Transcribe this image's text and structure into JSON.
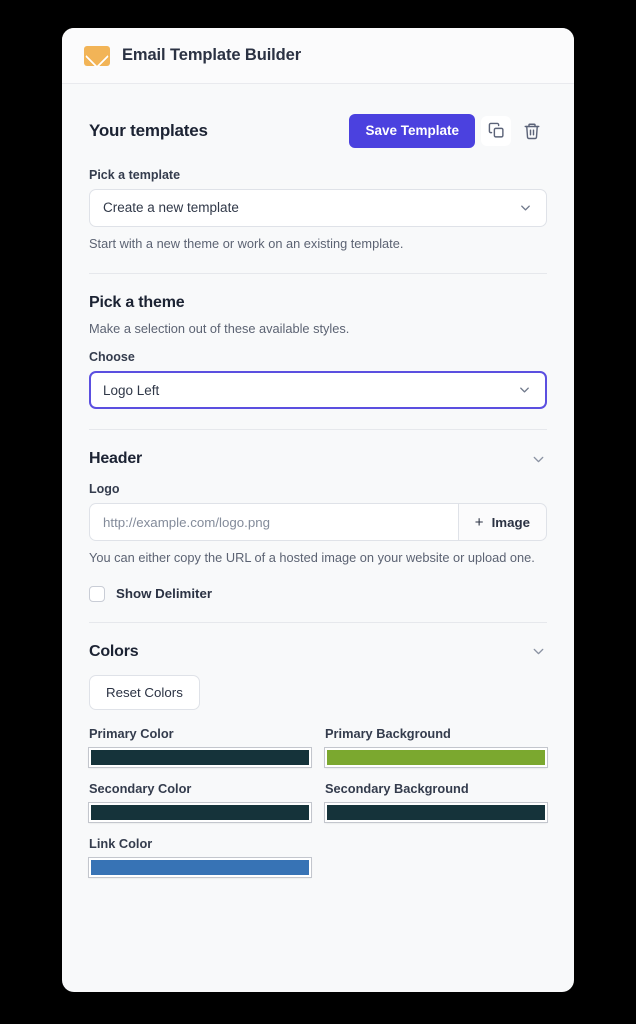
{
  "app": {
    "title": "Email Template Builder",
    "logo_icon": "envelope-icon"
  },
  "templates_section": {
    "heading": "Your templates",
    "save_button": "Save Template",
    "duplicate_icon": "copy-icon",
    "delete_icon": "trash-icon",
    "picker_label": "Pick a template",
    "picker_value": "Create a new template",
    "picker_chevron_icon": "chevron-down-icon",
    "helper_text": "Start with a new theme or work on an existing template."
  },
  "theme_section": {
    "heading": "Pick a theme",
    "subtitle": "Make a selection out of these available styles.",
    "choose_label": "Choose",
    "choose_value": "Logo Left",
    "choose_chevron_icon": "chevron-down-icon"
  },
  "header_section": {
    "heading": "Header",
    "collapse_icon": "chevron-down-icon",
    "logo_label": "Logo",
    "logo_placeholder": "http://example.com/logo.png",
    "logo_value": "",
    "image_button": "Image",
    "image_button_icon": "plus-icon",
    "helper_text": "You can either copy the URL of a hosted image on your website or upload one.",
    "delimiter_label": "Show Delimiter",
    "delimiter_checked": false
  },
  "colors_section": {
    "heading": "Colors",
    "collapse_icon": "chevron-down-icon",
    "reset_button": "Reset Colors",
    "swatches": [
      {
        "label": "Primary Color",
        "value": "#15333a"
      },
      {
        "label": "Primary Background",
        "value": "#7ba82f"
      },
      {
        "label": "Secondary Color",
        "value": "#15333a"
      },
      {
        "label": "Secondary Background",
        "value": "#15333a"
      },
      {
        "label": "Link Color",
        "value": "#3773b5"
      }
    ]
  },
  "theme_colors": {
    "accent": "#4b41df",
    "focus_border": "#5b4fe0",
    "envelope": "#f2b457"
  }
}
